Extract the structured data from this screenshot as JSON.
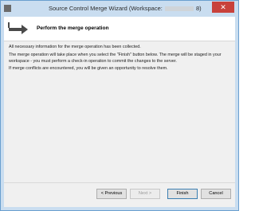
{
  "window": {
    "title_prefix": "Source Control Merge Wizard (Workspace:",
    "title_suffix": "8)",
    "close_label": "✕"
  },
  "header": {
    "title": "Perform the merge operation"
  },
  "body": {
    "line1": "All necessary information for the merge operation has been collected.",
    "line2": "The merge operation will take place when you select the \"Finish\" button below. The merge will be staged in your workspace - you must perform a check-in operation to commit the changes to the server.",
    "line3": "If merge conflicts are encountered, you will be given an opportunity to resolve them."
  },
  "buttons": {
    "previous": "< Previous",
    "next": "Next >",
    "finish": "Finish",
    "cancel": "Cancel"
  },
  "colors": {
    "title_bar": "#c9ddf0",
    "close_button": "#c8413b",
    "dialog_bg": "#f0f0f0"
  }
}
